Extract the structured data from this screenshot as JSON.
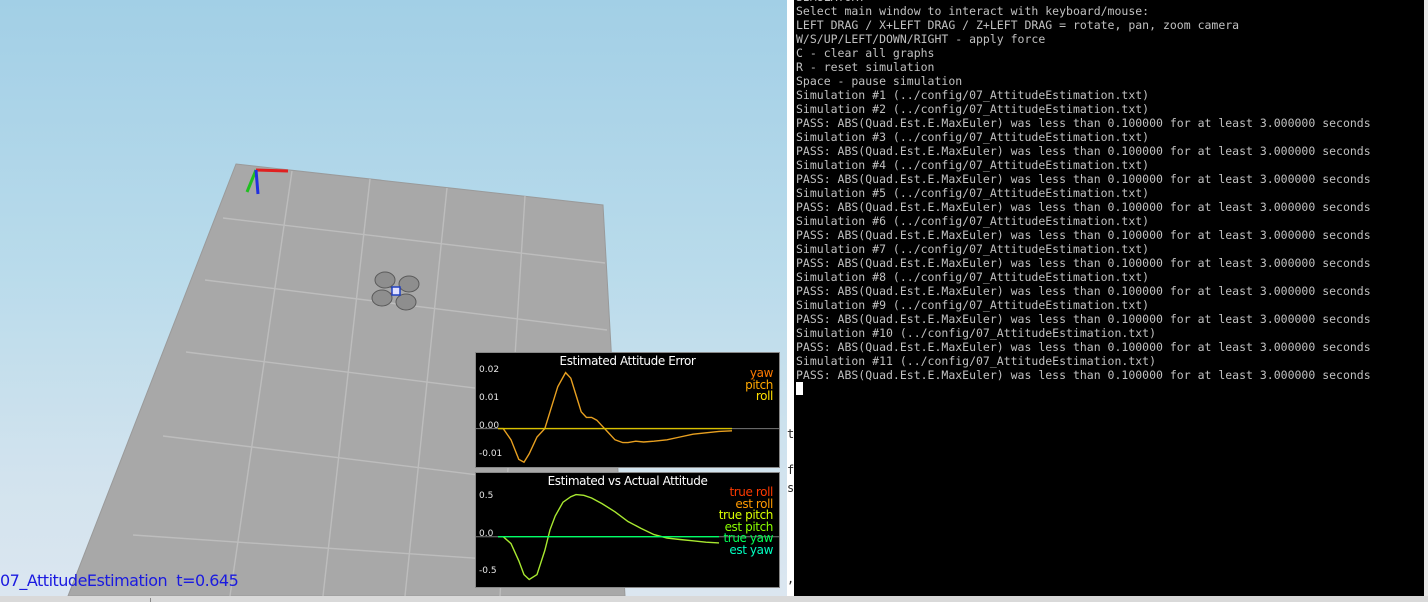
{
  "viewport": {
    "sim_label": "07_AttitudeEstimation  t=0.645"
  },
  "plots": {
    "error": {
      "title": "Estimated Attitude Error",
      "ticks": [
        "0.02",
        "0.01",
        "0.00",
        "-0.01"
      ],
      "legend": [
        {
          "label": "yaw",
          "color": "#ff7a00"
        },
        {
          "label": "pitch",
          "color": "#ffa800"
        },
        {
          "label": "roll",
          "color": "#ffe000"
        }
      ],
      "chart_data": {
        "type": "line",
        "ylim": [
          -0.013,
          0.022
        ],
        "series": [
          {
            "name": "pitch",
            "color": "#e8a020",
            "x": [
              0.0,
              0.02,
              0.05,
              0.08,
              0.1,
              0.12,
              0.15,
              0.18,
              0.2,
              0.23,
              0.26,
              0.28,
              0.3,
              0.32,
              0.34,
              0.36,
              0.38,
              0.4,
              0.42,
              0.45,
              0.48,
              0.5,
              0.53,
              0.56,
              0.6,
              0.65,
              0.7,
              0.75,
              0.8,
              0.85,
              0.9
            ],
            "y": [
              0.0,
              0.0,
              -0.004,
              -0.011,
              -0.012,
              -0.009,
              -0.003,
              0.0,
              0.006,
              0.015,
              0.02,
              0.018,
              0.012,
              0.006,
              0.004,
              0.004,
              0.003,
              0.001,
              -0.001,
              -0.004,
              -0.005,
              -0.005,
              -0.0045,
              -0.0048,
              -0.0045,
              -0.004,
              -0.003,
              -0.002,
              -0.0015,
              -0.001,
              -0.0008
            ]
          },
          {
            "name": "yaw",
            "color": "#d8c000",
            "x": [
              0.0,
              0.9
            ],
            "y": [
              0.0,
              0.0
            ]
          }
        ]
      }
    },
    "attitude": {
      "title": "Estimated vs Actual Attitude",
      "ticks": [
        "0.5",
        "0.0",
        "-0.5"
      ],
      "legend": [
        {
          "label": "true roll",
          "color": "#ff3a00"
        },
        {
          "label": "est roll",
          "color": "#ff9a00"
        },
        {
          "label": "true pitch",
          "color": "#d8ff00"
        },
        {
          "label": "est pitch",
          "color": "#8aff00"
        },
        {
          "label": "true yaw",
          "color": "#00ff55"
        },
        {
          "label": "est yaw",
          "color": "#00ffc0"
        }
      ],
      "chart_data": {
        "type": "line",
        "ylim": [
          -0.7,
          0.72
        ],
        "series": [
          {
            "name": "true pitch",
            "color": "#a8e830",
            "x": [
              0.0,
              0.02,
              0.05,
              0.08,
              0.1,
              0.12,
              0.15,
              0.18,
              0.2,
              0.22,
              0.25,
              0.28,
              0.3,
              0.33,
              0.36,
              0.4,
              0.45,
              0.5,
              0.55,
              0.6,
              0.65,
              0.7,
              0.75,
              0.8,
              0.85
            ],
            "y": [
              0.0,
              0.0,
              -0.1,
              -0.35,
              -0.55,
              -0.62,
              -0.55,
              -0.2,
              0.1,
              0.3,
              0.5,
              0.58,
              0.61,
              0.6,
              0.56,
              0.48,
              0.36,
              0.22,
              0.12,
              0.03,
              -0.02,
              -0.04,
              -0.06,
              -0.08,
              -0.09
            ]
          },
          {
            "name": "true yaw",
            "color": "#00ff66",
            "x": [
              0.0,
              0.85
            ],
            "y": [
              0.0,
              0.0
            ]
          }
        ]
      }
    }
  },
  "gap_text": [
    "t",
    "f",
    "s",
    ","
  ],
  "console": {
    "lines": [
      "SIMULATOR!",
      "Select main window to interact with keyboard/mouse:",
      "LEFT DRAG / X+LEFT DRAG / Z+LEFT DRAG = rotate, pan, zoom camera",
      "W/S/UP/LEFT/DOWN/RIGHT - apply force",
      "C - clear all graphs",
      "R - reset simulation",
      "Space - pause simulation",
      "Simulation #1 (../config/07_AttitudeEstimation.txt)",
      "Simulation #2 (../config/07_AttitudeEstimation.txt)",
      "PASS: ABS(Quad.Est.E.MaxEuler) was less than 0.100000 for at least 3.000000 seconds",
      "Simulation #3 (../config/07_AttitudeEstimation.txt)",
      "PASS: ABS(Quad.Est.E.MaxEuler) was less than 0.100000 for at least 3.000000 seconds",
      "Simulation #4 (../config/07_AttitudeEstimation.txt)",
      "PASS: ABS(Quad.Est.E.MaxEuler) was less than 0.100000 for at least 3.000000 seconds",
      "Simulation #5 (../config/07_AttitudeEstimation.txt)",
      "PASS: ABS(Quad.Est.E.MaxEuler) was less than 0.100000 for at least 3.000000 seconds",
      "Simulation #6 (../config/07_AttitudeEstimation.txt)",
      "PASS: ABS(Quad.Est.E.MaxEuler) was less than 0.100000 for at least 3.000000 seconds",
      "Simulation #7 (../config/07_AttitudeEstimation.txt)",
      "PASS: ABS(Quad.Est.E.MaxEuler) was less than 0.100000 for at least 3.000000 seconds",
      "Simulation #8 (../config/07_AttitudeEstimation.txt)",
      "PASS: ABS(Quad.Est.E.MaxEuler) was less than 0.100000 for at least 3.000000 seconds",
      "Simulation #9 (../config/07_AttitudeEstimation.txt)",
      "PASS: ABS(Quad.Est.E.MaxEuler) was less than 0.100000 for at least 3.000000 seconds",
      "Simulation #10 (../config/07_AttitudeEstimation.txt)",
      "PASS: ABS(Quad.Est.E.MaxEuler) was less than 0.100000 for at least 3.000000 seconds",
      "Simulation #11 (../config/07_AttitudeEstimation.txt)",
      "PASS: ABS(Quad.Est.E.MaxEuler) was less than 0.100000 for at least 3.000000 seconds"
    ]
  }
}
